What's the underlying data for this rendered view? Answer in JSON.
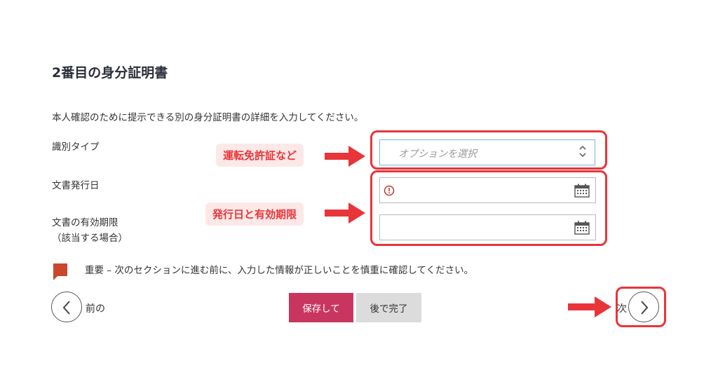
{
  "page_title": "2番目の身分証明書",
  "intro_text": "本人確認のために提示できる別の身分証明書の詳細を入力してください。",
  "form": {
    "id_type": {
      "label": "識別タイプ",
      "placeholder": "オプションを選択"
    },
    "issue_date": {
      "label": "文書発行日",
      "value": ""
    },
    "expiry_date": {
      "label_line1": "文書の有効期限",
      "label_line2": "（該当する場合）",
      "value": ""
    }
  },
  "annotations": {
    "callout_id_type": "運転免許証など",
    "callout_dates": "発行日と有効期限"
  },
  "notice": {
    "text": "重要 – 次のセクションに進む前に、入力した情報が正しいことを慎重に確認してください。"
  },
  "navigation": {
    "prev_label": "前の",
    "next_label": "次",
    "save_label": "保存して",
    "later_label": "後で完了"
  },
  "colors": {
    "accent_save": "#c8365f",
    "annotation_red": "#e8353a",
    "notice_icon": "#c9472a",
    "select_border": "#7fb3dd"
  },
  "icons": {
    "select_arrow": "chevron-down-icon",
    "calendar": "calendar-icon",
    "warning": "warning-circle-icon",
    "prev": "chevron-left-icon",
    "next": "chevron-right-icon",
    "notice": "flag-icon"
  }
}
